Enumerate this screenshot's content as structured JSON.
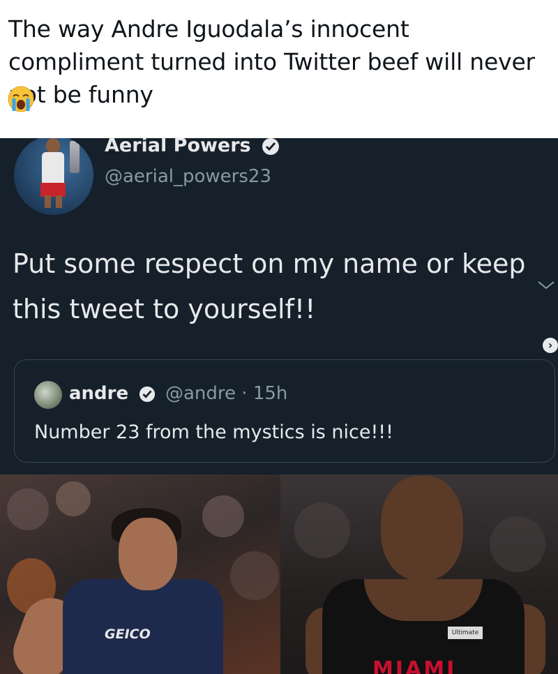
{
  "post": {
    "caption": "The way Andre Iguodala’s innocent compliment turned into Twitter beef will never not be funny",
    "emoji": "loudly-crying-face-emoji"
  },
  "tweet": {
    "display_name": "Aerial Powers",
    "handle": "@aerial_powers23",
    "verified": true,
    "text": "Put some respect on my name or keep this tweet to yourself!!",
    "menu_icon": "chevron-down-icon"
  },
  "quote": {
    "display_name": "andre",
    "meta": "@andre · 15h",
    "verified": true,
    "text": "Number 23 from the mystics is nice!!!"
  },
  "photos": {
    "left_jersey_text": "GEICO",
    "right_jersey_text": "MIAMI",
    "right_tag": "Ultimate"
  },
  "colors": {
    "panel_bg": "#15202b",
    "primary_text": "#e7e9ea",
    "secondary_text": "#8b98a5",
    "border": "#38444d"
  }
}
